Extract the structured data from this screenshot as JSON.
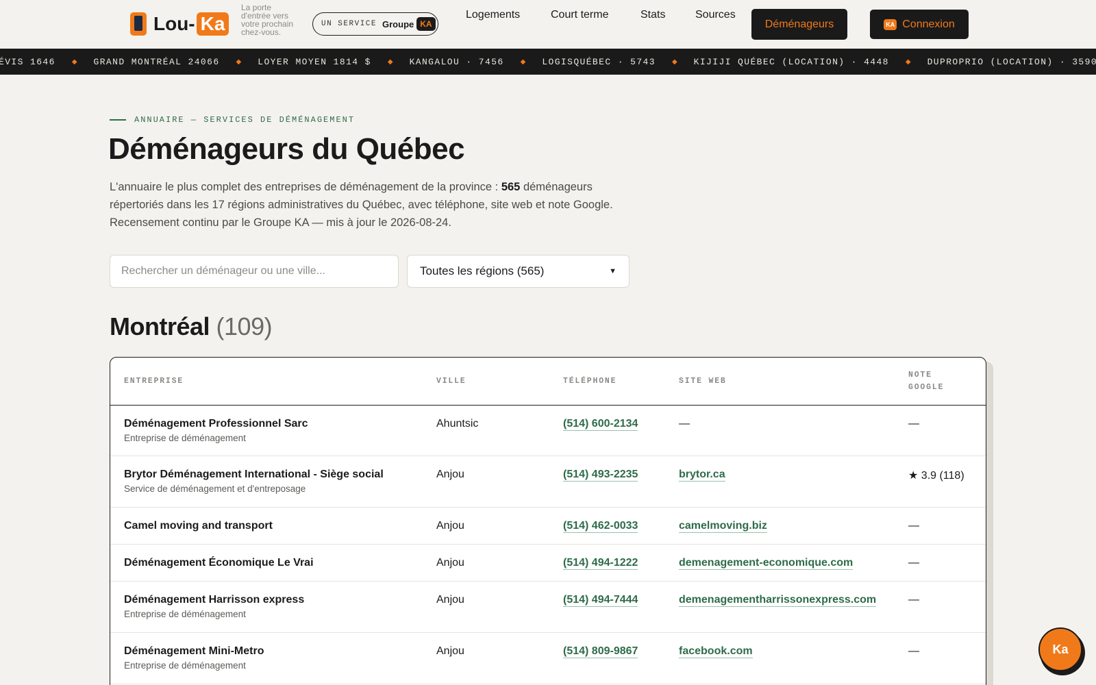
{
  "brand": {
    "name_prefix": "Lou-",
    "name_suffix": "Ka",
    "tagline": "La porte d'entrée vers votre prochain chez-vous.",
    "logo_icon": "phone-door-icon"
  },
  "service_pill": {
    "prefix": "UN SERVICE",
    "groupe": "Groupe",
    "badge": "KA"
  },
  "nav": {
    "items": [
      "Logements",
      "Court terme",
      "Stats",
      "Sources"
    ],
    "active": "Déménageurs",
    "login_badge": "KA",
    "login": "Connexion"
  },
  "ticker": [
    "ÉVIS 1646",
    "GRAND MONTRÉAL 24066",
    "LOYER MOYEN 1814 $",
    "KANGALOU · 7456",
    "LOGISQUÉBEC · 5743",
    "KIJIJI QUÉBEC (LOCATION) · 4448",
    "DUPROPRIO (LOCATION) · 3590"
  ],
  "hero": {
    "eyebrow": "ANNUAIRE — SERVICES DE DÉMÉNAGEMENT",
    "title": "Déménageurs du Québec",
    "intro_a": "L'annuaire le plus complet des entreprises de déménagement de la province : ",
    "intro_count": "565",
    "intro_b": " déménageurs répertoriés dans les 17 régions administratives du Québec, avec téléphone, site web et note Google. Recensement continu par le Groupe KA — mis à jour le 2026-08-24."
  },
  "search": {
    "placeholder": "Rechercher un déménageur ou une ville...",
    "region_selected": "Toutes les régions (565)"
  },
  "section": {
    "name": "Montréal",
    "count": "(109)"
  },
  "table": {
    "columns": {
      "company": "ENTREPRISE",
      "city": "VILLE",
      "phone": "TÉLÉPHONE",
      "website": "SITE WEB",
      "rating_1": "NOTE",
      "rating_2": "GOOGLE"
    },
    "rows": [
      {
        "name": "Déménagement Professionnel Sarc",
        "sub": "Entreprise de déménagement",
        "city": "Ahuntsic",
        "phone": "(514) 600-2134",
        "site": "—",
        "rating": "—"
      },
      {
        "name": "Brytor Déménagement International - Siège social",
        "sub": "Service de déménagement et d'entreposage",
        "city": "Anjou",
        "phone": "(514) 493-2235",
        "site": "brytor.ca",
        "rating": "★ 3.9 (118)"
      },
      {
        "name": "Camel moving and transport",
        "sub": "",
        "city": "Anjou",
        "phone": "(514) 462-0033",
        "site": "camelmoving.biz",
        "rating": "—"
      },
      {
        "name": "Déménagement Économique Le Vrai",
        "sub": "",
        "city": "Anjou",
        "phone": "(514) 494-1222",
        "site": "demenagement-economique.com",
        "rating": "—"
      },
      {
        "name": "Déménagement Harrisson express",
        "sub": "Entreprise de déménagement",
        "city": "Anjou",
        "phone": "(514) 494-7444",
        "site": "demenagementharrissonexpress.com",
        "rating": "—"
      },
      {
        "name": "Déménagement Mini-Metro",
        "sub": "Entreprise de déménagement",
        "city": "Anjou",
        "phone": "(514) 809-9867",
        "site": "facebook.com",
        "rating": "—"
      }
    ]
  },
  "fab": {
    "label": "Ka"
  },
  "colors": {
    "accent": "#f07a1a",
    "dark": "#1a1a1a",
    "green": "#2e6b4a",
    "background": "#f4f2ee"
  }
}
